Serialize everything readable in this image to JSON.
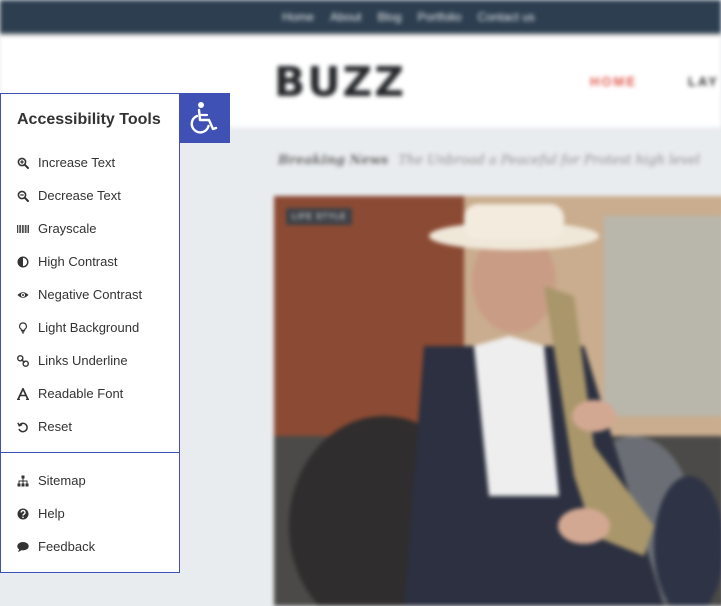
{
  "site": {
    "top_nav": [
      "Home",
      "About",
      "Blog",
      "Portfolio",
      "Contact us"
    ],
    "logo": "BUZZ",
    "main_nav_active": "HOME",
    "main_nav_next": "LAY",
    "breaking_label": "Breaking News",
    "breaking_headline": "The Unbroad a Peaceful for Protest high level",
    "category_badge": "LIFE STYLE"
  },
  "a11y": {
    "toggle_icon": "wheelchair-icon",
    "title": "Accessibility Tools",
    "tools": [
      {
        "label": "Increase Text",
        "icon": "zoom-in-icon"
      },
      {
        "label": "Decrease Text",
        "icon": "zoom-out-icon"
      },
      {
        "label": "Grayscale",
        "icon": "barcode-icon"
      },
      {
        "label": "High Contrast",
        "icon": "half-circle-icon"
      },
      {
        "label": "Negative Contrast",
        "icon": "eye-icon"
      },
      {
        "label": "Light Background",
        "icon": "lightbulb-icon"
      },
      {
        "label": "Links Underline",
        "icon": "link-icon"
      },
      {
        "label": "Readable Font",
        "icon": "font-icon"
      },
      {
        "label": "Reset",
        "icon": "reset-icon"
      }
    ],
    "extras": [
      {
        "label": "Sitemap",
        "icon": "sitemap-icon"
      },
      {
        "label": "Help",
        "icon": "help-icon"
      },
      {
        "label": "Feedback",
        "icon": "comment-icon"
      }
    ],
    "accent_color": "#3f51b5"
  }
}
